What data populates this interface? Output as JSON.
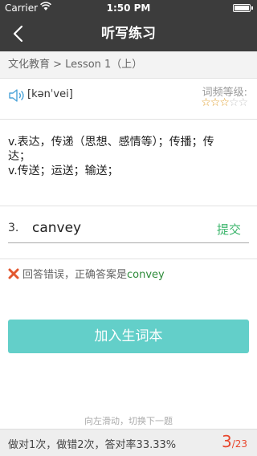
{
  "status_bar": {
    "carrier": "Carrier",
    "time": "1:50 PM"
  },
  "nav": {
    "back_icon": "chevron-left",
    "title": "听写练习"
  },
  "breadcrumb": "文化教育 > Lesson 1（上）",
  "word": {
    "phonetic": "[kənˈvei]",
    "frequency_label": "词频等级:",
    "stars_filled": 3,
    "stars_total": 5,
    "definition_lines": [
      "v.表达，传递（思想、感情等）；传播；传",
      "达；",
      "v.传送；运送；输送；"
    ]
  },
  "answer": {
    "number": "3.",
    "value": "canvey",
    "submit_label": "提交"
  },
  "feedback": {
    "icon": "cross-icon",
    "prefix": "回答错误，正确答案是",
    "correct_answer": "convey"
  },
  "add_button_label": "加入生词本",
  "swipe_hint": "向左滑动，切换下一题",
  "footer": {
    "stats": "做对1次，做错2次，答对率33.33%",
    "current": "3",
    "total": "/23"
  },
  "colors": {
    "bar": "#3c3c3c",
    "accent_teal": "#63cfc9",
    "submit_green": "#3bb56b",
    "correct_green": "#2e8b3a",
    "error_red": "#e8472d",
    "star": "#e0a030"
  }
}
